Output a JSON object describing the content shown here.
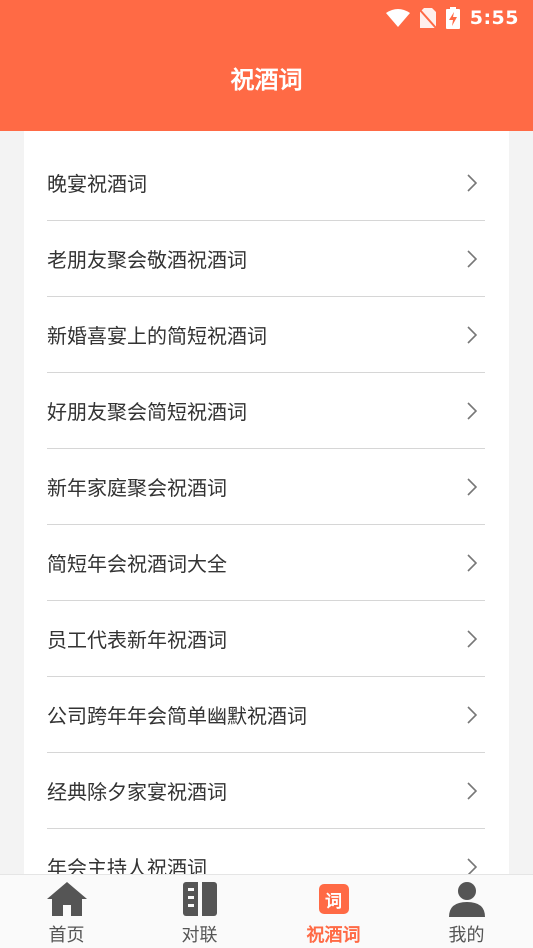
{
  "status_bar": {
    "time": "5:55"
  },
  "header": {
    "title": "祝酒词"
  },
  "list": {
    "items": [
      {
        "label": "晚宴祝酒词"
      },
      {
        "label": "老朋友聚会敬酒祝酒词"
      },
      {
        "label": "新婚喜宴上的简短祝酒词"
      },
      {
        "label": "好朋友聚会简短祝酒词"
      },
      {
        "label": "新年家庭聚会祝酒词"
      },
      {
        "label": "简短年会祝酒词大全"
      },
      {
        "label": "员工代表新年祝酒词"
      },
      {
        "label": "公司跨年年会简单幽默祝酒词"
      },
      {
        "label": "经典除夕家宴祝酒词"
      },
      {
        "label": "年会主持人祝酒词"
      }
    ]
  },
  "tabs": [
    {
      "label": "首页",
      "icon": "home-icon",
      "active": false
    },
    {
      "label": "对联",
      "icon": "couplet-icon",
      "active": false
    },
    {
      "label": "祝酒词",
      "icon": "toast-words-icon",
      "badge": "词",
      "active": true
    },
    {
      "label": "我的",
      "icon": "user-icon",
      "active": false
    }
  ],
  "colors": {
    "accent": "#ff6a45",
    "text": "#333333",
    "divider": "#d6d6d6",
    "tab_inactive": "#555555"
  }
}
